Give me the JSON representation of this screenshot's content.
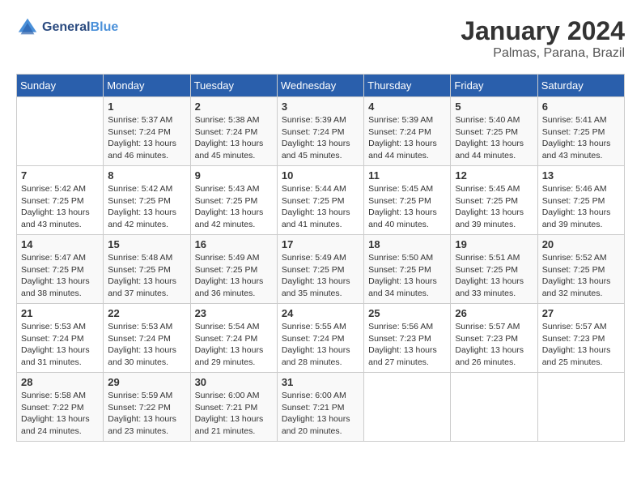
{
  "header": {
    "logo_general": "General",
    "logo_blue": "Blue",
    "title": "January 2024",
    "subtitle": "Palmas, Parana, Brazil"
  },
  "days_of_week": [
    "Sunday",
    "Monday",
    "Tuesday",
    "Wednesday",
    "Thursday",
    "Friday",
    "Saturday"
  ],
  "weeks": [
    [
      {
        "day": "",
        "info": ""
      },
      {
        "day": "1",
        "info": "Sunrise: 5:37 AM\nSunset: 7:24 PM\nDaylight: 13 hours\nand 46 minutes."
      },
      {
        "day": "2",
        "info": "Sunrise: 5:38 AM\nSunset: 7:24 PM\nDaylight: 13 hours\nand 45 minutes."
      },
      {
        "day": "3",
        "info": "Sunrise: 5:39 AM\nSunset: 7:24 PM\nDaylight: 13 hours\nand 45 minutes."
      },
      {
        "day": "4",
        "info": "Sunrise: 5:39 AM\nSunset: 7:24 PM\nDaylight: 13 hours\nand 44 minutes."
      },
      {
        "day": "5",
        "info": "Sunrise: 5:40 AM\nSunset: 7:25 PM\nDaylight: 13 hours\nand 44 minutes."
      },
      {
        "day": "6",
        "info": "Sunrise: 5:41 AM\nSunset: 7:25 PM\nDaylight: 13 hours\nand 43 minutes."
      }
    ],
    [
      {
        "day": "7",
        "info": "Sunrise: 5:42 AM\nSunset: 7:25 PM\nDaylight: 13 hours\nand 43 minutes."
      },
      {
        "day": "8",
        "info": "Sunrise: 5:42 AM\nSunset: 7:25 PM\nDaylight: 13 hours\nand 42 minutes."
      },
      {
        "day": "9",
        "info": "Sunrise: 5:43 AM\nSunset: 7:25 PM\nDaylight: 13 hours\nand 42 minutes."
      },
      {
        "day": "10",
        "info": "Sunrise: 5:44 AM\nSunset: 7:25 PM\nDaylight: 13 hours\nand 41 minutes."
      },
      {
        "day": "11",
        "info": "Sunrise: 5:45 AM\nSunset: 7:25 PM\nDaylight: 13 hours\nand 40 minutes."
      },
      {
        "day": "12",
        "info": "Sunrise: 5:45 AM\nSunset: 7:25 PM\nDaylight: 13 hours\nand 39 minutes."
      },
      {
        "day": "13",
        "info": "Sunrise: 5:46 AM\nSunset: 7:25 PM\nDaylight: 13 hours\nand 39 minutes."
      }
    ],
    [
      {
        "day": "14",
        "info": "Sunrise: 5:47 AM\nSunset: 7:25 PM\nDaylight: 13 hours\nand 38 minutes."
      },
      {
        "day": "15",
        "info": "Sunrise: 5:48 AM\nSunset: 7:25 PM\nDaylight: 13 hours\nand 37 minutes."
      },
      {
        "day": "16",
        "info": "Sunrise: 5:49 AM\nSunset: 7:25 PM\nDaylight: 13 hours\nand 36 minutes."
      },
      {
        "day": "17",
        "info": "Sunrise: 5:49 AM\nSunset: 7:25 PM\nDaylight: 13 hours\nand 35 minutes."
      },
      {
        "day": "18",
        "info": "Sunrise: 5:50 AM\nSunset: 7:25 PM\nDaylight: 13 hours\nand 34 minutes."
      },
      {
        "day": "19",
        "info": "Sunrise: 5:51 AM\nSunset: 7:25 PM\nDaylight: 13 hours\nand 33 minutes."
      },
      {
        "day": "20",
        "info": "Sunrise: 5:52 AM\nSunset: 7:25 PM\nDaylight: 13 hours\nand 32 minutes."
      }
    ],
    [
      {
        "day": "21",
        "info": "Sunrise: 5:53 AM\nSunset: 7:24 PM\nDaylight: 13 hours\nand 31 minutes."
      },
      {
        "day": "22",
        "info": "Sunrise: 5:53 AM\nSunset: 7:24 PM\nDaylight: 13 hours\nand 30 minutes."
      },
      {
        "day": "23",
        "info": "Sunrise: 5:54 AM\nSunset: 7:24 PM\nDaylight: 13 hours\nand 29 minutes."
      },
      {
        "day": "24",
        "info": "Sunrise: 5:55 AM\nSunset: 7:24 PM\nDaylight: 13 hours\nand 28 minutes."
      },
      {
        "day": "25",
        "info": "Sunrise: 5:56 AM\nSunset: 7:23 PM\nDaylight: 13 hours\nand 27 minutes."
      },
      {
        "day": "26",
        "info": "Sunrise: 5:57 AM\nSunset: 7:23 PM\nDaylight: 13 hours\nand 26 minutes."
      },
      {
        "day": "27",
        "info": "Sunrise: 5:57 AM\nSunset: 7:23 PM\nDaylight: 13 hours\nand 25 minutes."
      }
    ],
    [
      {
        "day": "28",
        "info": "Sunrise: 5:58 AM\nSunset: 7:22 PM\nDaylight: 13 hours\nand 24 minutes."
      },
      {
        "day": "29",
        "info": "Sunrise: 5:59 AM\nSunset: 7:22 PM\nDaylight: 13 hours\nand 23 minutes."
      },
      {
        "day": "30",
        "info": "Sunrise: 6:00 AM\nSunset: 7:21 PM\nDaylight: 13 hours\nand 21 minutes."
      },
      {
        "day": "31",
        "info": "Sunrise: 6:00 AM\nSunset: 7:21 PM\nDaylight: 13 hours\nand 20 minutes."
      },
      {
        "day": "",
        "info": ""
      },
      {
        "day": "",
        "info": ""
      },
      {
        "day": "",
        "info": ""
      }
    ]
  ]
}
